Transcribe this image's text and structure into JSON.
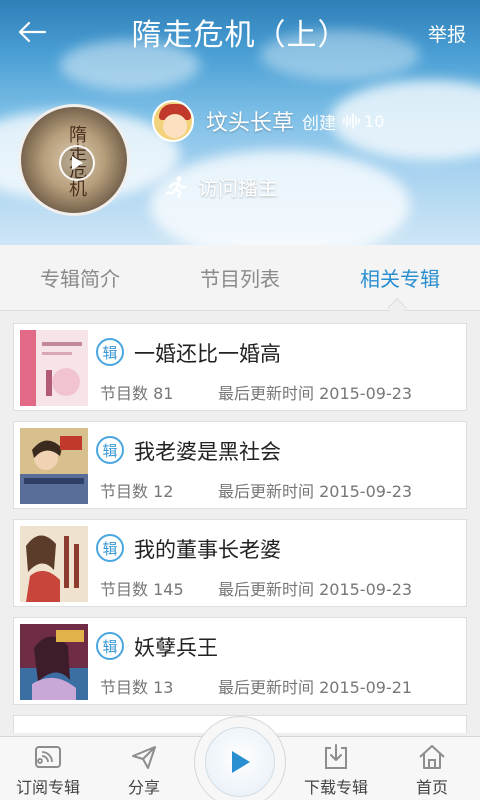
{
  "header": {
    "title": "隋走危机（上）",
    "report_label": "举报"
  },
  "album": {
    "cover_text": "隋走危机",
    "creator_name": "坟头长草",
    "created_label": "创建",
    "listen_count": "10",
    "visit_label": "访问播主"
  },
  "tabs": [
    {
      "label": "专辑简介",
      "active": false
    },
    {
      "label": "节目列表",
      "active": false
    },
    {
      "label": "相关专辑",
      "active": true
    }
  ],
  "related_albums": [
    {
      "badge": "辑",
      "title": "一婚还比一婚高",
      "count_label": "节目数 81",
      "updated": "最后更新时间 2015-09-23",
      "thumb_color": "#f3d6dc"
    },
    {
      "badge": "辑",
      "title": "我老婆是黑社会",
      "count_label": "节目数 12",
      "updated": "最后更新时间 2015-09-23",
      "thumb_color": "#c9a46a"
    },
    {
      "badge": "辑",
      "title": "我的董事长老婆",
      "count_label": "节目数 145",
      "updated": "最后更新时间 2015-09-23",
      "thumb_color": "#e9d2b6"
    },
    {
      "badge": "辑",
      "title": "妖孽兵王",
      "count_label": "节目数 13",
      "updated": "最后更新时间 2015-09-21",
      "thumb_color": "#a44a5e"
    }
  ],
  "bottom_nav": {
    "subscribe": "订阅专辑",
    "share": "分享",
    "download": "下载专辑",
    "home": "首页"
  },
  "colors": {
    "accent": "#2a8fd0",
    "title_text": "#222222",
    "meta_text": "#777777"
  }
}
